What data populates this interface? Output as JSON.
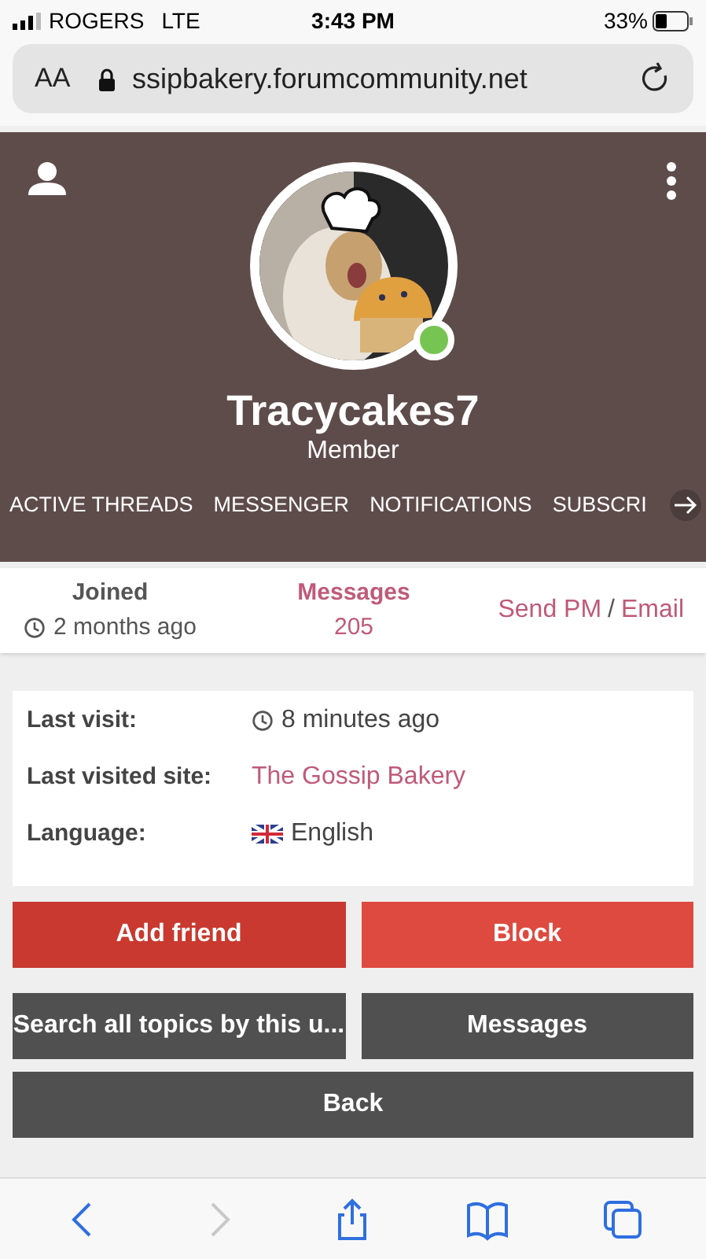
{
  "status_bar": {
    "carrier": "ROGERS",
    "network": "LTE",
    "time": "3:43 PM",
    "battery": "33%"
  },
  "address_bar": {
    "text_size": "AA",
    "url": "ssipbakery.forumcommunity.net"
  },
  "profile": {
    "username": "Tracycakes7",
    "role": "Member",
    "online": true
  },
  "tabs": [
    {
      "label": "ACTIVE THREADS"
    },
    {
      "label": "MESSENGER"
    },
    {
      "label": "NOTIFICATIONS"
    },
    {
      "label": "SUBSCRI"
    }
  ],
  "stats": {
    "joined_label": "Joined",
    "joined_value": "2 months ago",
    "messages_label": "Messages",
    "messages_value": "205",
    "send_pm": "Send PM",
    "separator": "/",
    "email": "Email"
  },
  "info": [
    {
      "label": "Last visit:",
      "value": "8 minutes ago",
      "kind": "time"
    },
    {
      "label": "Last visited site:",
      "value": "The Gossip Bakery",
      "kind": "link"
    },
    {
      "label": "Language:",
      "value": "English",
      "kind": "flag"
    }
  ],
  "buttons": [
    [
      {
        "label": "Add friend",
        "kind": "primary"
      },
      {
        "label": "Block",
        "kind": "danger"
      }
    ],
    [
      {
        "label": "Search all topics by this u...",
        "kind": "dark"
      },
      {
        "label": "Messages",
        "kind": "dark"
      }
    ],
    [
      {
        "label": "Back",
        "kind": "dark"
      }
    ]
  ],
  "toolbar": [
    {
      "kind": "back",
      "disabled": false
    },
    {
      "kind": "forward",
      "disabled": true
    },
    {
      "kind": "share",
      "disabled": false
    },
    {
      "kind": "bookmarks",
      "disabled": false
    },
    {
      "kind": "tabs",
      "disabled": false
    }
  ]
}
